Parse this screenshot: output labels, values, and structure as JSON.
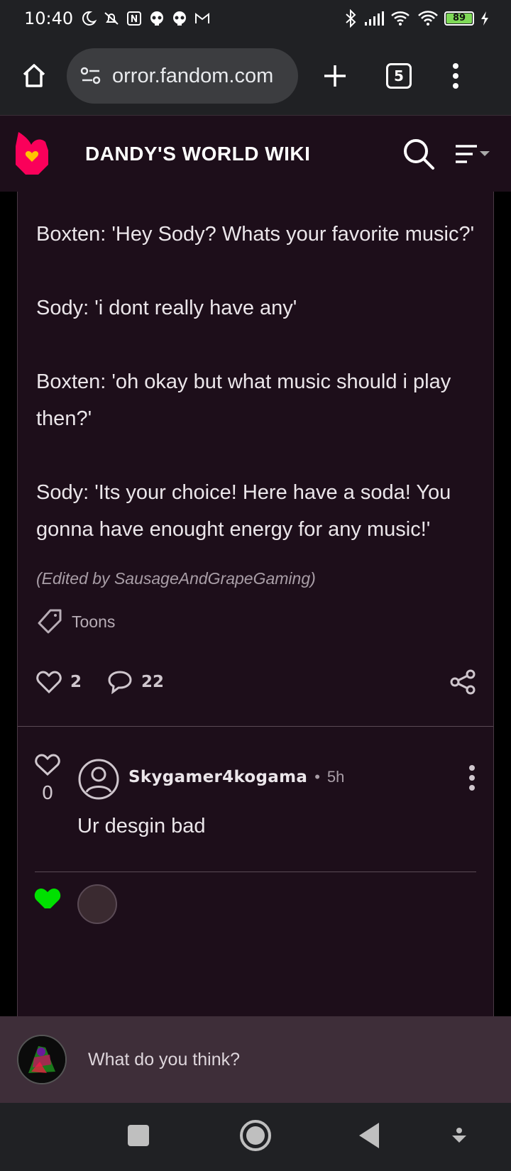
{
  "status_bar": {
    "time": "10:40",
    "battery": "89",
    "icons": [
      "moon-icon",
      "mute-icon",
      "nfc-icon",
      "skull-icon",
      "skull-icon",
      "gmail-icon",
      "bluetooth-icon",
      "signal-icon",
      "wifi-calling-icon",
      "wifi-icon",
      "battery-icon",
      "charging-icon"
    ]
  },
  "browser": {
    "url": "orror.fandom.com",
    "tab_count": "5"
  },
  "wiki": {
    "title": "DANDY'S WORLD WIKI",
    "accent": "#fa005a"
  },
  "post": {
    "lines": [
      "Boxten: 'Hey Sody? Whats your favorite music?'",
      "Sody: 'i dont really have any'",
      "Boxten: 'oh okay but what music should i play then?'",
      "Sody: 'Its your choice! Here have a soda! You gonna have enought energy for any music!'"
    ],
    "edited_note": "(Edited by SausageAndGrapeGaming)",
    "tag": "Toons",
    "likes": "2",
    "comments": "22"
  },
  "reply": {
    "likes": "0",
    "author": "Skygamer4kogama",
    "separator": "•",
    "time": "5h",
    "text": "Ur desgin bad",
    "next_heart_color": "#00e000"
  },
  "composer": {
    "placeholder": "What do you think?"
  }
}
